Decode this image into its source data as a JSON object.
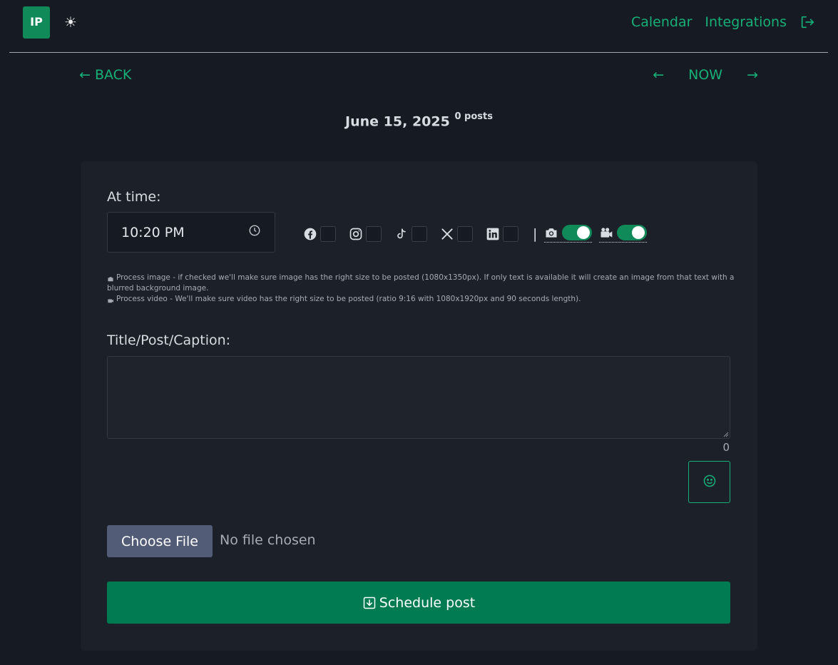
{
  "header": {
    "logo_text": "IP",
    "theme_icon": "sun-icon",
    "nav": {
      "calendar": "Calendar",
      "integrations": "Integrations"
    },
    "logout_icon": "logout-icon"
  },
  "pager": {
    "back": "← BACK",
    "prev": "←",
    "now": "NOW",
    "next": "→"
  },
  "day": {
    "date": "June 15, 2025",
    "posts": "0 posts"
  },
  "form": {
    "time_label": "At time:",
    "time_value": "10:20 PM",
    "socials": [
      {
        "name": "facebook",
        "checked": false
      },
      {
        "name": "instagram",
        "checked": false
      },
      {
        "name": "tiktok",
        "checked": false
      },
      {
        "name": "x",
        "checked": false
      },
      {
        "name": "linkedin",
        "checked": false
      }
    ],
    "separator": "|",
    "process_image_on": true,
    "process_video_on": true,
    "help_image": "Process image - if checked we'll make sure image has the right size to be posted (1080x1350px). If only text is available it will create an image from that text with a blurred background image.",
    "help_video": "Process video - We'll make sure video has the right size to be posted (ratio 9:16 with 1080x1920px and 90 seconds length).",
    "caption_label": "Title/Post/Caption:",
    "caption_value": "",
    "char_count": "0",
    "choose_file": "Choose File",
    "no_file": "No file chosen",
    "schedule": "Schedule post"
  },
  "colors": {
    "accent": "#16b078",
    "button_green": "#007b52",
    "background": "#161a22",
    "card": "#1c2028"
  }
}
